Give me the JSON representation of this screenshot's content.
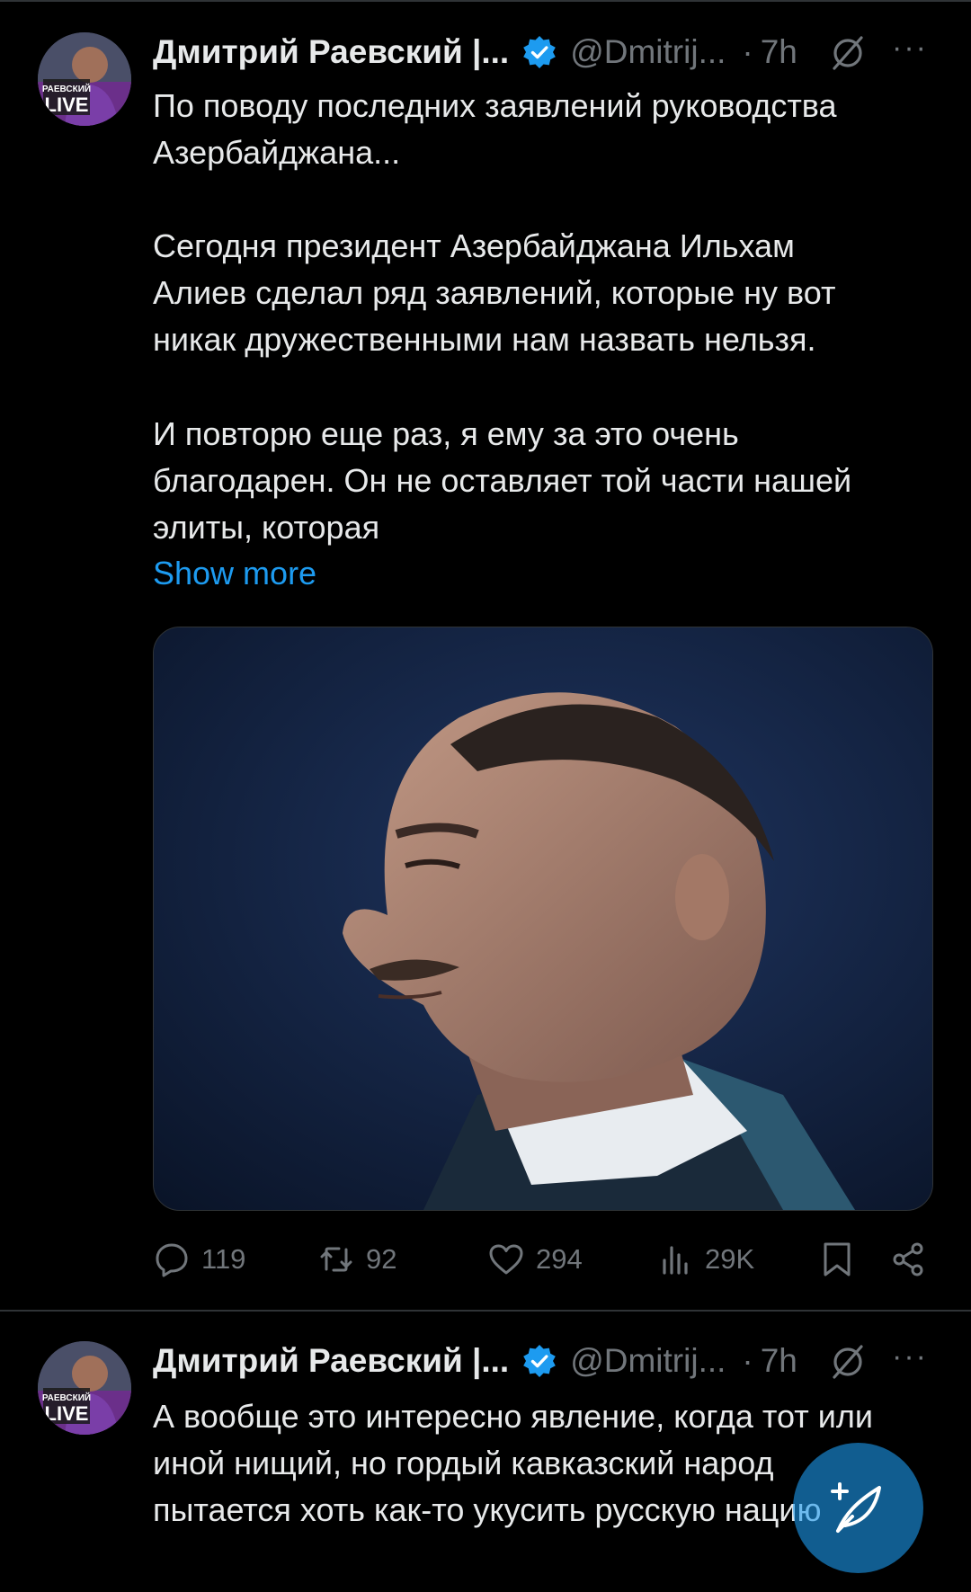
{
  "tweets": [
    {
      "author_name": "Дмитрий Раевский |...",
      "handle": "@Dmitrij...",
      "dot": "·",
      "time": "7h",
      "more": "···",
      "avatar_text": {
        "top": "РАЕВСКИЙ",
        "bottom": "LIVE"
      },
      "paragraphs": [
        "По поводу последних заявлений руководства\nАзербайджана...",
        "Сегодня президент Азербайджана Ильхам\nАлиев сделал ряд заявлений, которые ну вот\nникак дружественными нам назвать нельзя.",
        "И повторю еще раз, я ему за это очень\nблагодарен. Он не оставляет той части нашей\nэлиты, которая"
      ],
      "show_more": "Show more",
      "stats": {
        "replies": "119",
        "reposts": "92",
        "likes": "294",
        "views": "29K"
      }
    },
    {
      "author_name": "Дмитрий Раевский |...",
      "handle": "@Dmitrij...",
      "dot": "·",
      "time": "7h",
      "more": "···",
      "avatar_text": {
        "top": "РАЕВСКИЙ",
        "bottom": "LIVE"
      },
      "paragraphs": [
        "А вообще это интересно явление, когда тот или\nиной нищий, но гордый кавказский народ\nпытается хоть как-то укусить русскую нацию"
      ]
    }
  ],
  "icons": {
    "verified": "verified-badge-icon",
    "grok": "grok-icon",
    "reply": "reply-icon",
    "repost": "repost-icon",
    "like": "heart-icon",
    "views": "views-icon",
    "bookmark": "bookmark-icon",
    "share": "share-icon",
    "compose": "compose-icon"
  },
  "colors": {
    "background": "#000000",
    "text": "#e7e9ea",
    "secondary": "#71767b",
    "link": "#1d9bf0",
    "verified": "#1d9bf0"
  }
}
